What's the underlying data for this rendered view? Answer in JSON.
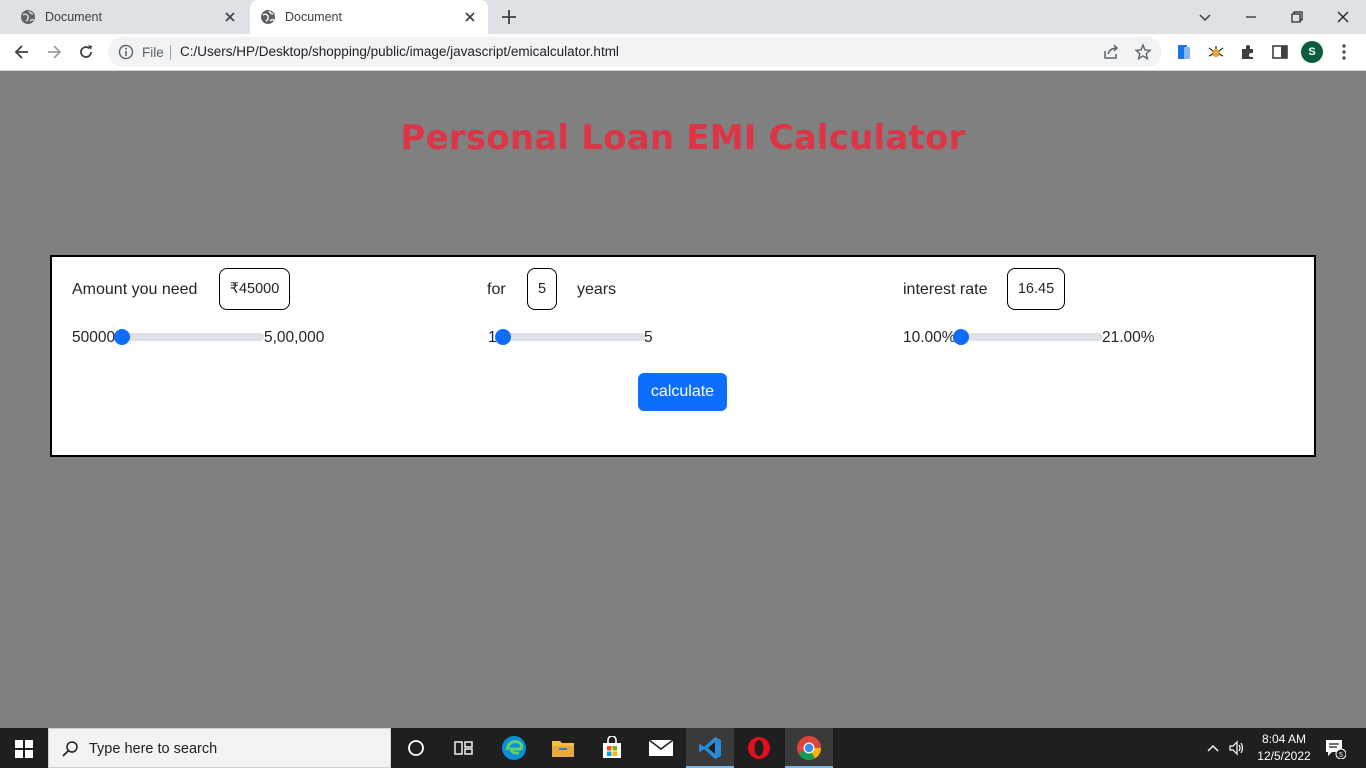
{
  "browser": {
    "tabs": [
      {
        "title": "Document",
        "active": false
      },
      {
        "title": "Document",
        "active": true
      }
    ],
    "address": {
      "scheme_label": "File",
      "url": "C:/Users/HP/Desktop/shopping/public/image/javascript/emicalculator.html"
    },
    "profile_initial": "S"
  },
  "page": {
    "title": "Personal Loan EMI Calculator",
    "amount": {
      "label": "Amount you need",
      "value": "₹45000",
      "min_label": "50000",
      "max_label": "5,00,000",
      "slider_level": 0.0
    },
    "tenure": {
      "prefix_label": "for",
      "value": "5",
      "suffix_label": "years",
      "min_label": "1",
      "max_label": "5",
      "slider_level": 0.0
    },
    "interest": {
      "label": "interest rate",
      "value": "16.45",
      "min_label": "10.00%",
      "max_label": "21.00%",
      "slider_level": 0.0
    },
    "calculate_label": "calculate"
  },
  "taskbar": {
    "search_placeholder": "Type here to search",
    "time": "8:04 AM",
    "date": "12/5/2022",
    "notification_count": "5"
  },
  "colors": {
    "page_background": "#808080",
    "title": "#dc3545",
    "accent": "#0d6efd"
  }
}
